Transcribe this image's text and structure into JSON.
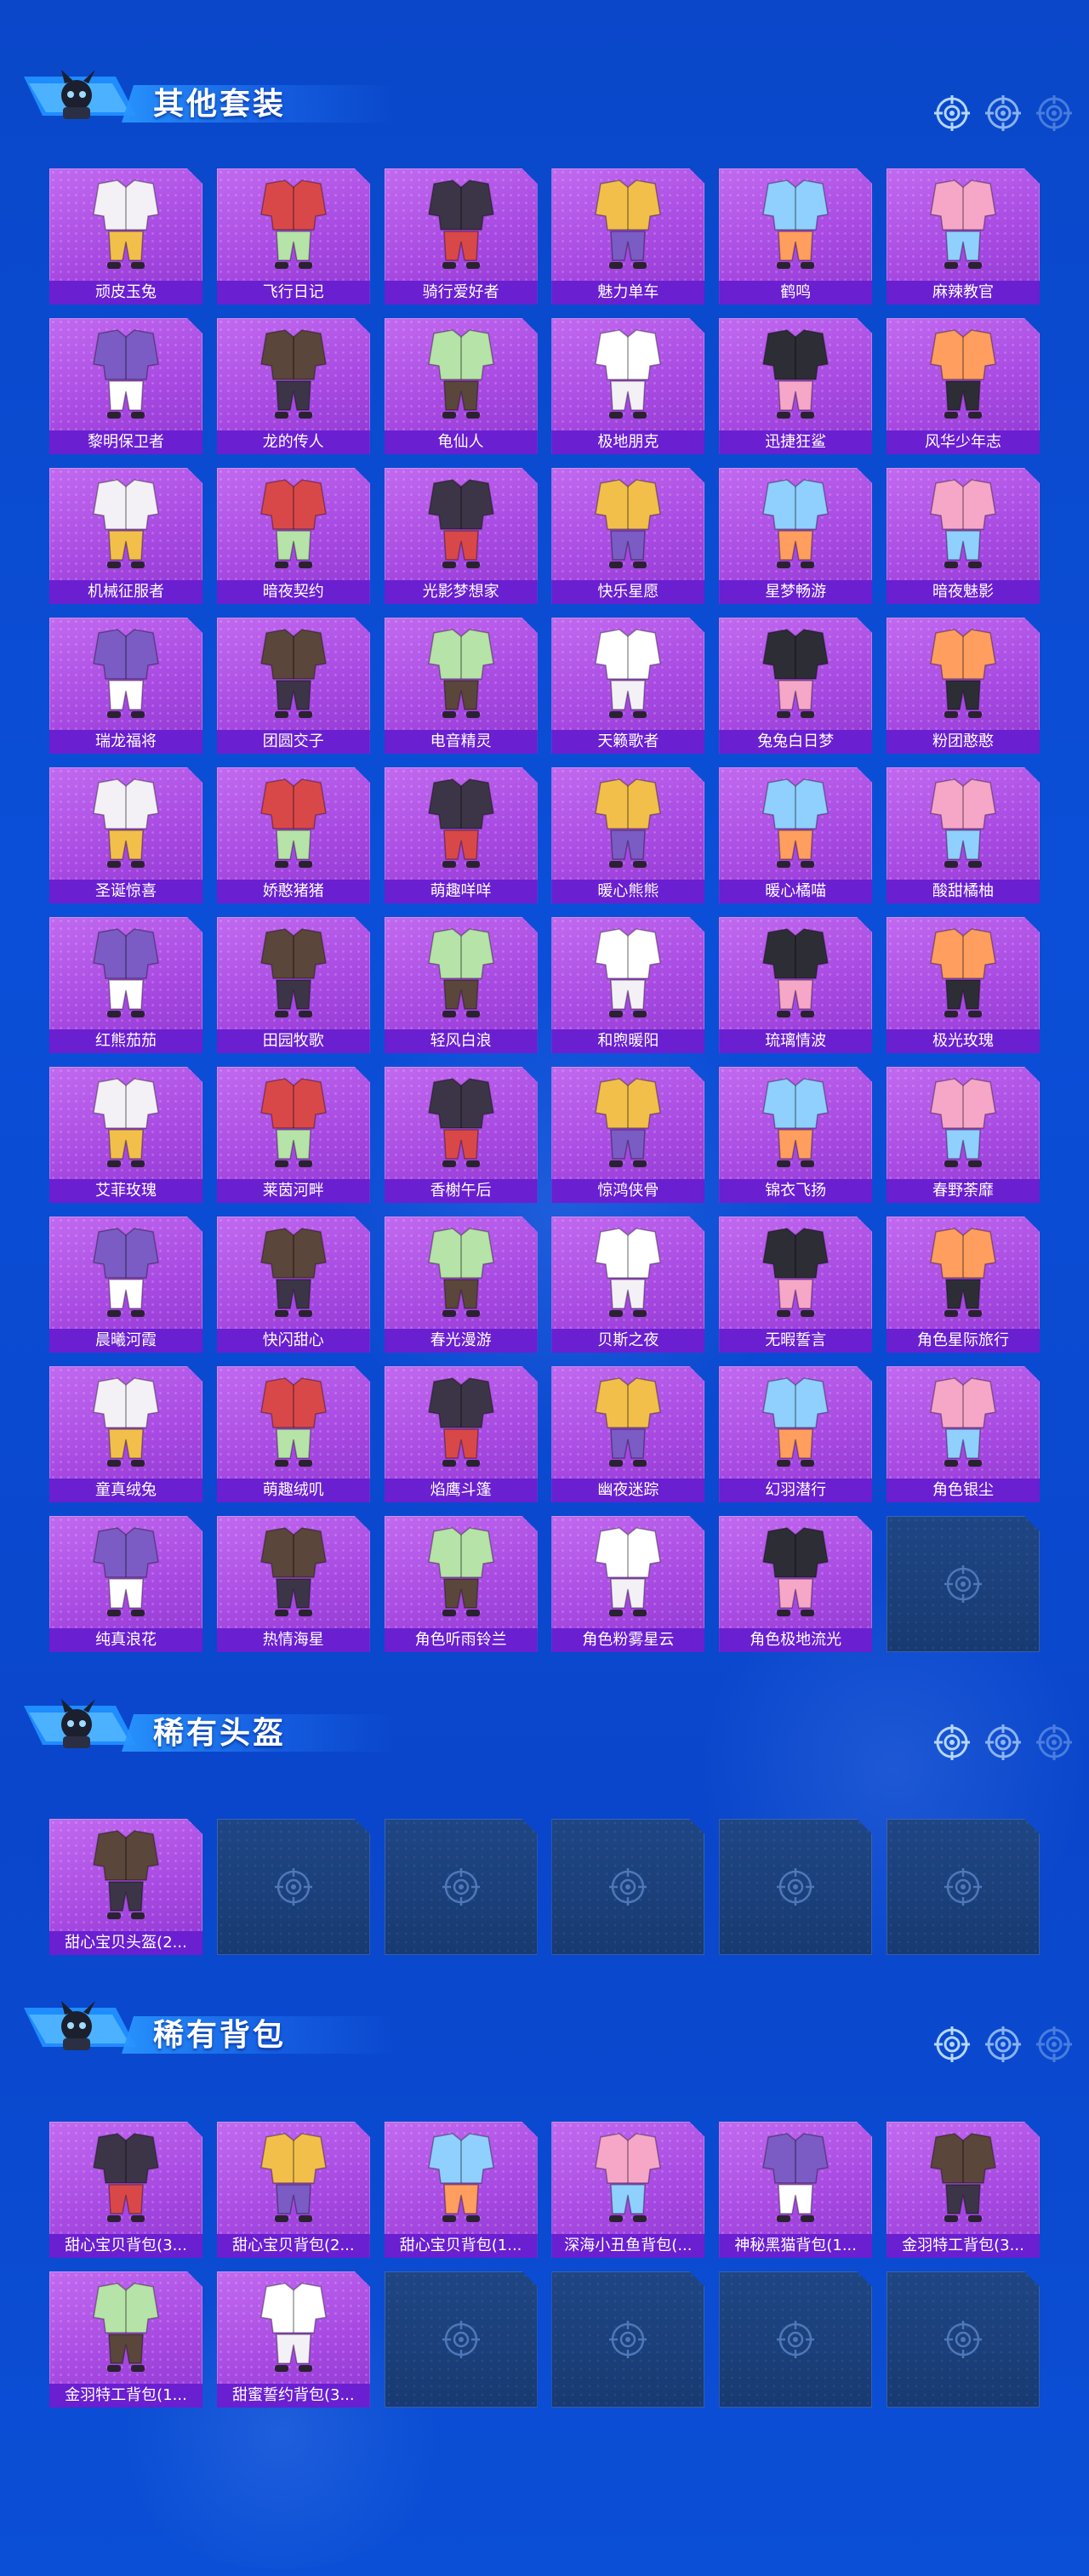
{
  "colors": {
    "background": "#0b4fd8",
    "card": "#b455e8",
    "card_label_bg": "#6a1fd1",
    "empty_slot": "#1c3f78",
    "title_text": "#ffffff"
  },
  "header_icons": [
    "crosshair-icon",
    "crosshair-icon",
    "crosshair-icon"
  ],
  "sections": [
    {
      "title": "其他套装",
      "items": [
        "顽皮玉兔",
        "飞行日记",
        "骑行爱好者",
        "魅力单车",
        "鹤鸣",
        "麻辣教官",
        "黎明保卫者",
        "龙的传人",
        "龟仙人",
        "极地朋克",
        "迅捷狂鲨",
        "风华少年志",
        "机械征服者",
        "暗夜契约",
        "光影梦想家",
        "快乐星愿",
        "星梦畅游",
        "暗夜魅影",
        "瑞龙福将",
        "团圆交子",
        "电音精灵",
        "天籁歌者",
        "兔兔白日梦",
        "粉团憨憨",
        "圣诞惊喜",
        "娇憨猪猪",
        "萌趣咩咩",
        "暖心熊熊",
        "暖心橘喵",
        "酸甜橘柚",
        "红熊茄茄",
        "田园牧歌",
        "轻风白浪",
        "和煦暖阳",
        "琉璃情波",
        "极光玫瑰",
        "艾菲玫瑰",
        "莱茵河畔",
        "香榭午后",
        "惊鸿侠骨",
        "锦衣飞扬",
        "春野荼靡",
        "晨曦河霞",
        "快闪甜心",
        "春光漫游",
        "贝斯之夜",
        "无暇誓言",
        "角色星际旅行",
        "童真绒兔",
        "萌趣绒叽",
        "焰鹰斗篷",
        "幽夜迷踪",
        "幻羽潜行",
        "角色银尘",
        "纯真浪花",
        "热情海星",
        "角色听雨铃兰",
        "角色粉雾星云",
        "角色极地流光"
      ],
      "empty_slots": 1
    },
    {
      "title": "稀有头盔",
      "items": [
        "甜心宝贝头盔(2..."
      ],
      "empty_slots": 5
    },
    {
      "title": "稀有背包",
      "items": [
        "甜心宝贝背包(3...",
        "甜心宝贝背包(2...",
        "甜心宝贝背包(1...",
        "深海小丑鱼背包(...",
        "神秘黑猫背包(1...",
        "金羽特工背包(3...",
        "金羽特工背包(1...",
        "甜蜜誓约背包(3..."
      ],
      "empty_slots": 4
    }
  ]
}
